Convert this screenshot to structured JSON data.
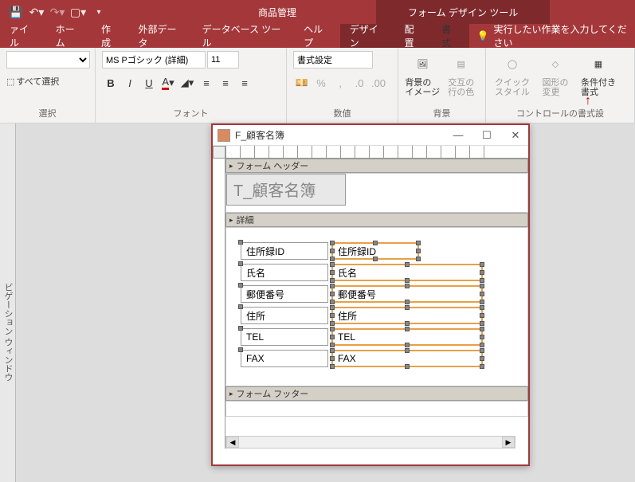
{
  "app_title": "商品管理",
  "context_title": "フォーム デザイン ツール",
  "tabs": {
    "file": "ァイル",
    "home": "ホーム",
    "create": "作成",
    "external": "外部データ",
    "dbtools": "データベース ツール",
    "help": "ヘルプ",
    "design": "デザイン",
    "arrange": "配置",
    "format": "書式"
  },
  "tell_me": "実行したい作業を入力してください",
  "selection": {
    "select_all": "すべて選択",
    "group": "選択"
  },
  "font": {
    "name": "MS Pゴシック (詳細)",
    "size": "11",
    "format_btn": "書式設定",
    "group": "フォント"
  },
  "number": {
    "group": "数値"
  },
  "background": {
    "bg_image": "背景の\nイメージ",
    "alt_row": "交互の\n行の色",
    "group": "背景"
  },
  "control_fmt": {
    "quick": "クイック\nスタイル",
    "shape": "図形の\n変更",
    "conditional": "条件付き\n書式",
    "group": "コントロールの書式設"
  },
  "form_window": {
    "title": "F_顧客名簿"
  },
  "sections": {
    "header": "フォーム ヘッダー",
    "detail": "詳細",
    "footer": "フォーム フッター"
  },
  "form_title": "T_顧客名簿",
  "fields": [
    {
      "label": "住所録ID",
      "control": "住所録ID",
      "width": 110
    },
    {
      "label": "氏名",
      "control": "氏名",
      "width": 190
    },
    {
      "label": "郵便番号",
      "control": "郵便番号",
      "width": 190
    },
    {
      "label": "住所",
      "control": "住所",
      "width": 190
    },
    {
      "label": "TEL",
      "control": "TEL",
      "width": 190
    },
    {
      "label": "FAX",
      "control": "FAX",
      "width": 190
    }
  ],
  "nav_pane_text": "ビゲーション ウィンドウ"
}
